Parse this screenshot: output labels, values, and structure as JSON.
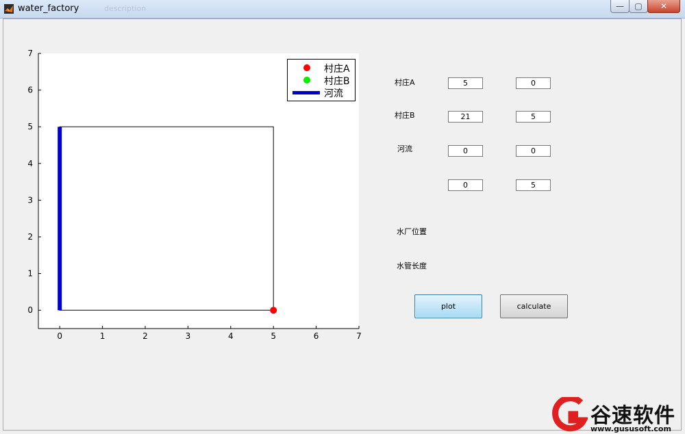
{
  "window": {
    "title": "water_factory",
    "ghost_tab": "description",
    "minimize": "—",
    "maximize": "▢",
    "close": "✕"
  },
  "chart_data": {
    "type": "scatter",
    "xlim": [
      -0.5,
      7
    ],
    "ylim": [
      -0.5,
      7
    ],
    "x_ticks": [
      0,
      1,
      2,
      3,
      4,
      5,
      6,
      7
    ],
    "y_ticks": [
      0,
      1,
      2,
      3,
      4,
      5,
      6,
      7
    ],
    "grid": false,
    "legend_position": "top-right",
    "series": [
      {
        "name": "村庄A",
        "kind": "point",
        "color": "#ff0000",
        "points": [
          [
            5,
            0
          ]
        ]
      },
      {
        "name": "村庄B",
        "kind": "point",
        "color": "#00ee00",
        "points": [
          [
            21,
            5
          ]
        ]
      },
      {
        "name": "河流",
        "kind": "line",
        "color": "#0000cc",
        "points": [
          [
            0,
            0
          ],
          [
            0,
            5
          ]
        ]
      }
    ],
    "box": {
      "x": [
        0,
        5
      ],
      "y": [
        0,
        5
      ]
    }
  },
  "panel": {
    "village_a_label": "村庄A",
    "village_b_label": "村庄B",
    "river_label": "河流",
    "village_a_x": "5",
    "village_a_y": "0",
    "village_b_x": "21",
    "village_b_y": "5",
    "river_start_x": "0",
    "river_start_y": "0",
    "river_end_x": "0",
    "river_end_y": "5",
    "plant_location_label": "水厂位置",
    "pipe_length_label": "水管长度"
  },
  "buttons": {
    "plot": "plot",
    "calculate": "calculate"
  },
  "watermark": {
    "name": "谷速软件",
    "url": "www.gususoft.com"
  }
}
